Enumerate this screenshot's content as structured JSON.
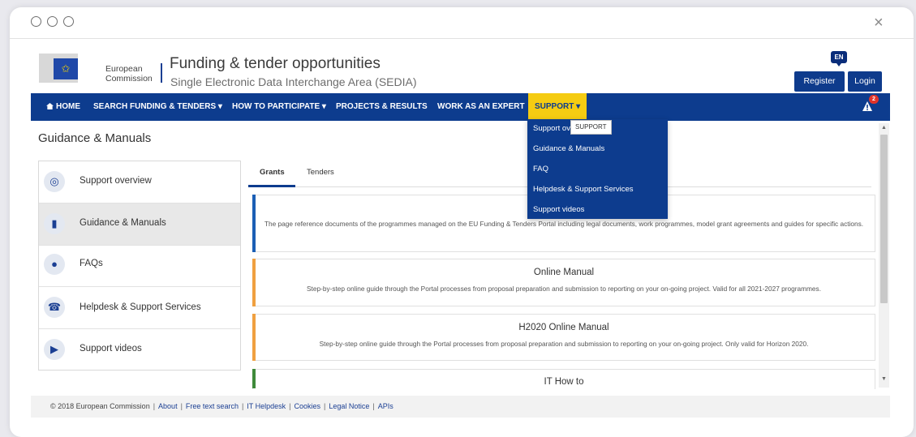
{
  "window": {
    "close_glyph": "×"
  },
  "header": {
    "logo_line1": "European",
    "logo_line2": "Commission",
    "title": "Funding & tender opportunities",
    "subtitle": "Single Electronic Data Interchange Area (SEDIA)",
    "language": "EN",
    "register_label": "Register",
    "login_label": "Login"
  },
  "nav": {
    "items": [
      {
        "label": "HOME"
      },
      {
        "label": "SEARCH FUNDING & TENDERS ▾"
      },
      {
        "label": "HOW TO PARTICIPATE ▾"
      },
      {
        "label": "PROJECTS & RESULTS"
      },
      {
        "label": "WORK AS AN EXPERT"
      },
      {
        "label": "SUPPORT ▾"
      }
    ],
    "alert_count": "2",
    "accent_color": "#f5cc12",
    "bar_color": "#0d3c8e"
  },
  "dropdown": {
    "tooltip": "SUPPORT",
    "items": [
      {
        "label": "Support ov"
      },
      {
        "label": "Guidance & Manuals"
      },
      {
        "label": "FAQ"
      },
      {
        "label": "Helpdesk & Support Services"
      },
      {
        "label": "Support videos"
      }
    ]
  },
  "page": {
    "title": "Guidance & Manuals"
  },
  "sidebar": {
    "items": [
      {
        "label": "Support overview",
        "icon": "lifebuoy-icon"
      },
      {
        "label": "Guidance & Manuals",
        "icon": "book-icon"
      },
      {
        "label": "FAQs",
        "icon": "chat-bubble-icon"
      },
      {
        "label": "Helpdesk & Support Services",
        "icon": "phone-icon"
      },
      {
        "label": "Support videos",
        "icon": "play-icon"
      }
    ]
  },
  "tabs": [
    {
      "label": "Grants"
    },
    {
      "label": "Tenders"
    }
  ],
  "cards": [
    {
      "title": "Re",
      "description": "The page reference documents of the programmes managed on the EU Funding & Tenders Portal including legal documents, work programmes, model grant agreements and guides for specific actions.",
      "accent": "#1b5fb5"
    },
    {
      "title": "Online Manual",
      "description": "Step-by-step online guide through the Portal processes from proposal preparation and submission to reporting on your on-going project. Valid for all 2021-2027 programmes.",
      "accent": "#f0a040"
    },
    {
      "title": "H2020 Online Manual",
      "description": "Step-by-step online guide through the Portal processes from proposal preparation and submission to reporting on your on-going project. Only valid for Horizon 2020.",
      "accent": "#f0a040"
    },
    {
      "title": "IT How to",
      "description": "",
      "accent": "#3f8a3a"
    }
  ],
  "footer": {
    "copyright": "© 2018 European Commission",
    "links": [
      {
        "label": "About"
      },
      {
        "label": "Free text search"
      },
      {
        "label": "IT Helpdesk"
      },
      {
        "label": "Cookies"
      },
      {
        "label": "Legal Notice"
      },
      {
        "label": "APIs"
      }
    ]
  }
}
